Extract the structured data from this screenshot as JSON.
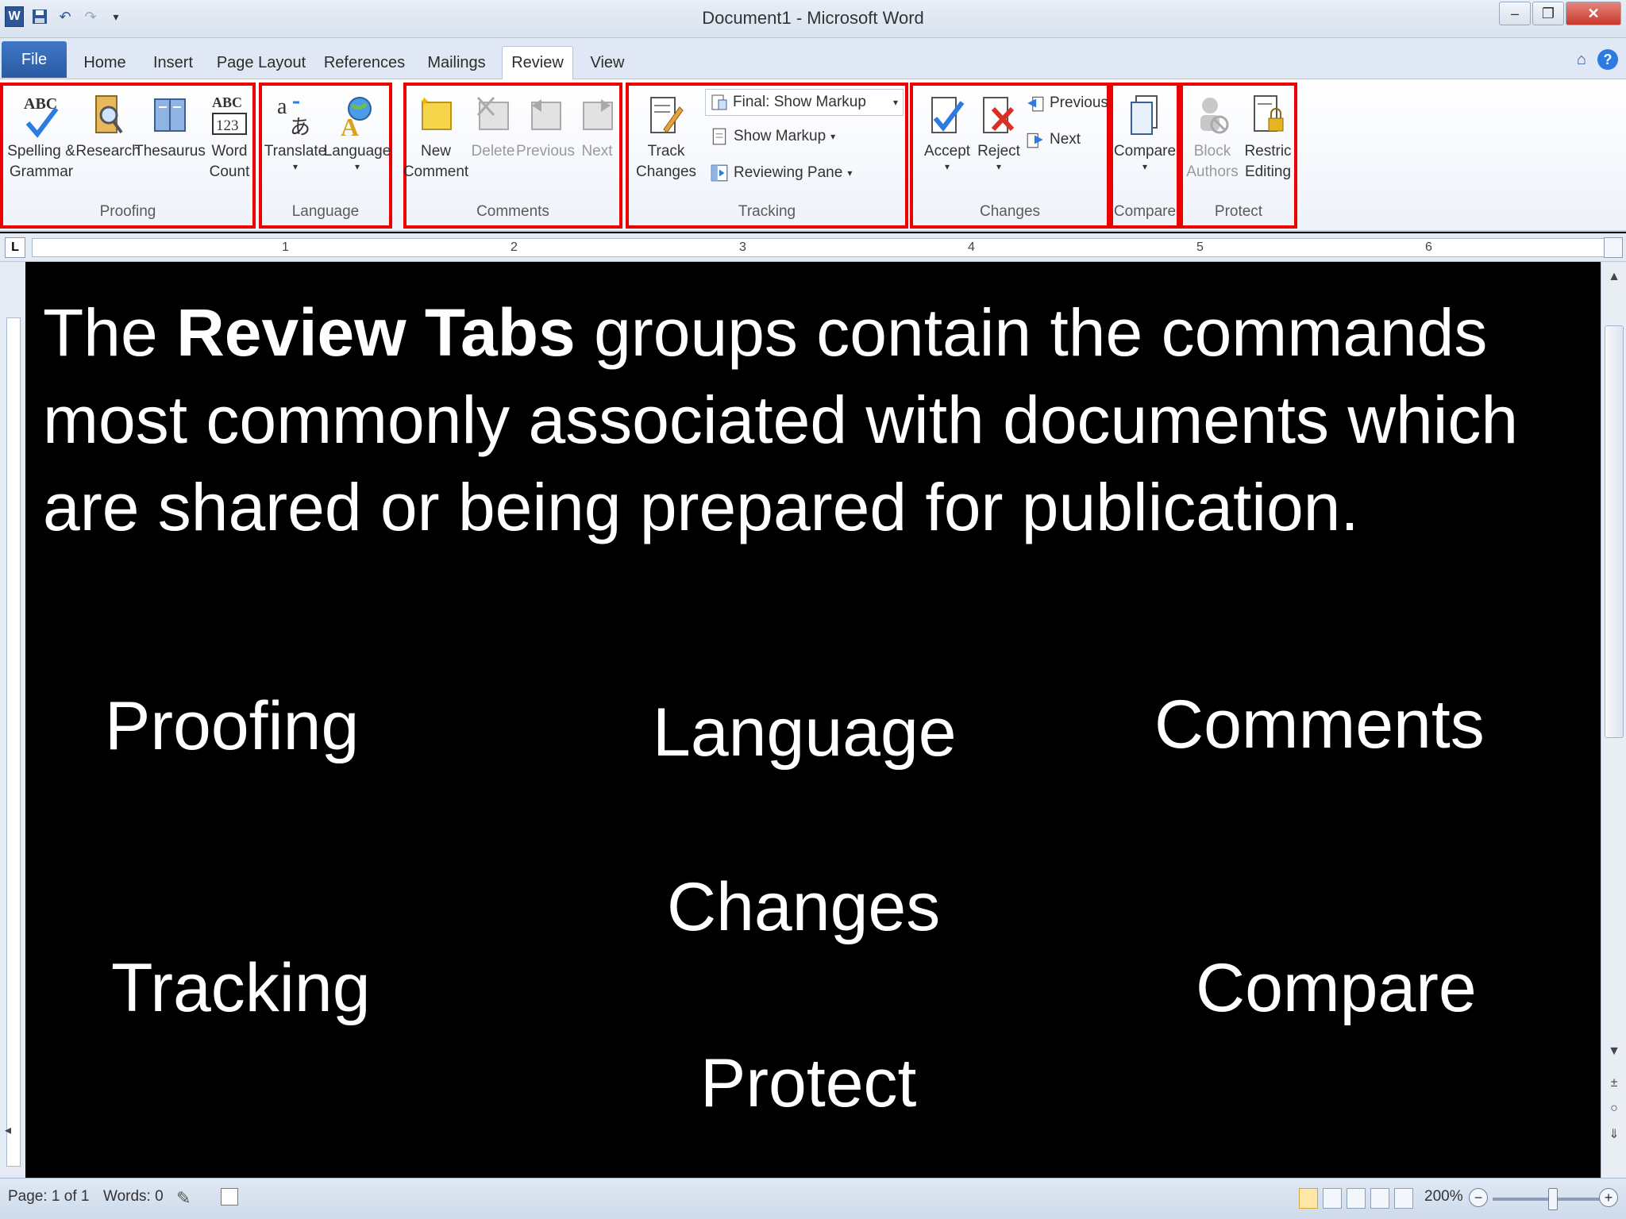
{
  "titlebar": {
    "title": "Document1 - Microsoft Word"
  },
  "tabs": {
    "file": "File",
    "home": "Home",
    "insert": "Insert",
    "page_layout": "Page Layout",
    "references": "References",
    "mailings": "Mailings",
    "review": "Review",
    "view": "View"
  },
  "ribbon": {
    "proofing": {
      "label": "Proofing",
      "spelling": "Spelling &\nGrammar",
      "research": "Research",
      "thesaurus": "Thesaurus",
      "word_count": "Word\nCount"
    },
    "language": {
      "label": "Language",
      "translate": "Translate",
      "language": "Language"
    },
    "comments": {
      "label": "Comments",
      "new": "New\nComment",
      "delete": "Delete",
      "previous": "Previous",
      "next": "Next"
    },
    "tracking": {
      "label": "Tracking",
      "track_changes": "Track\nChanges",
      "final_markup": "Final: Show Markup",
      "show_markup": "Show Markup",
      "reviewing_pane": "Reviewing Pane"
    },
    "changes": {
      "label": "Changes",
      "accept": "Accept",
      "reject": "Reject",
      "previous": "Previous",
      "next": "Next"
    },
    "compare": {
      "label": "Compare",
      "compare": "Compare"
    },
    "protect": {
      "label": "Protect",
      "block": "Block\nAuthors",
      "restrict": "Restric\nEditing"
    }
  },
  "ruler": {
    "numbers": [
      "1",
      "2",
      "3",
      "4",
      "5",
      "6"
    ]
  },
  "slide": {
    "headline_pre": "The ",
    "headline_bold": "Review Tabs",
    "headline_post": " groups contain the commands most commonly associated with documents which are shared or being prepared for publication.",
    "terms": {
      "proofing": "Proofing",
      "language": "Language",
      "comments": "Comments",
      "changes": "Changes",
      "tracking": "Tracking",
      "compare": "Compare",
      "protect": "Protect"
    }
  },
  "statusbar": {
    "page": "Page: 1 of 1",
    "words": "Words: 0",
    "zoom": "200%"
  },
  "colors": {
    "highlight": "#e00000",
    "ribbon_blue": "#2b579a",
    "slide_bg": "#000000",
    "slide_text": "#ffffff"
  }
}
